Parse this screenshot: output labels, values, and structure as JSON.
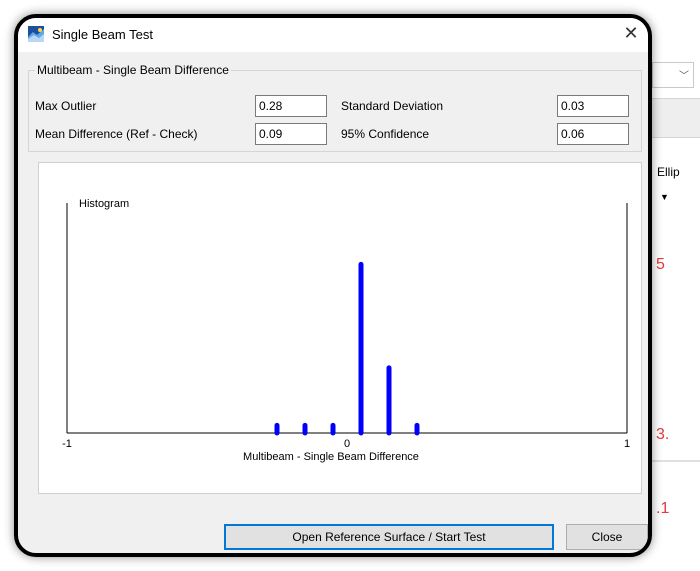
{
  "dialog": {
    "title": "Single Beam Test",
    "close_glyph": "✕",
    "icon": "app-globe-icon"
  },
  "stats": {
    "group_title": "Multibeam - Single Beam Difference",
    "max_outlier_label": "Max Outlier",
    "max_outlier_value": "0.28",
    "mean_diff_label": "Mean Difference (Ref - Check)",
    "mean_diff_value": "0.09",
    "std_dev_label": "Standard Deviation",
    "std_dev_value": "0.03",
    "confidence_label": "95% Confidence",
    "confidence_value": "0.06"
  },
  "chart_data": {
    "type": "bar",
    "title": "Histogram",
    "xlabel": "Multibeam - Single Beam Difference",
    "ylabel": "",
    "xlim": [
      -1,
      1
    ],
    "x_ticks": [
      "-1",
      "0",
      "1"
    ],
    "x": [
      -0.25,
      -0.15,
      -0.05,
      0.05,
      0.15,
      0.25
    ],
    "values": [
      1,
      1,
      1,
      22,
      8.5,
      1
    ],
    "ylim": [
      0,
      30
    ],
    "bar_color": "#0000ff",
    "grid": false
  },
  "buttons": {
    "start_label": "Open Reference Surface / Start Test",
    "close_label": "Close"
  },
  "background": {
    "ellip_text": "Ellip",
    "red_fragments": [
      "5",
      "3.",
      ".1"
    ]
  }
}
